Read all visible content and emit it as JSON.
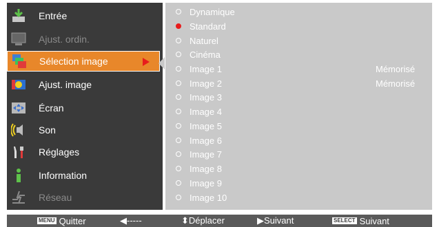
{
  "menu": {
    "items": [
      {
        "label": "Entrée",
        "icon": "input-icon",
        "state": "normal"
      },
      {
        "label": "Ajust. ordin.",
        "icon": "pc-adjust-icon",
        "state": "disabled"
      },
      {
        "label": "Sélection image",
        "icon": "image-select-icon",
        "state": "selected"
      },
      {
        "label": "Ajust. image",
        "icon": "image-adjust-icon",
        "state": "normal"
      },
      {
        "label": "Écran",
        "icon": "screen-icon",
        "state": "normal"
      },
      {
        "label": "Son",
        "icon": "sound-icon",
        "state": "normal"
      },
      {
        "label": "Réglages",
        "icon": "settings-icon",
        "state": "normal"
      },
      {
        "label": "Information",
        "icon": "information-icon",
        "state": "normal"
      },
      {
        "label": "Réseau",
        "icon": "network-icon",
        "state": "disabled"
      }
    ]
  },
  "options": [
    {
      "label": "Dynamique",
      "selected": false,
      "note": ""
    },
    {
      "label": "Standard",
      "selected": true,
      "note": ""
    },
    {
      "label": "Naturel",
      "selected": false,
      "note": ""
    },
    {
      "label": "Cinéma",
      "selected": false,
      "note": ""
    },
    {
      "label": "Image 1",
      "selected": false,
      "note": "Mémorisé"
    },
    {
      "label": "Image 2",
      "selected": false,
      "note": "Mémorisé"
    },
    {
      "label": "Image 3",
      "selected": false,
      "note": ""
    },
    {
      "label": "Image 4",
      "selected": false,
      "note": ""
    },
    {
      "label": "Image 5",
      "selected": false,
      "note": ""
    },
    {
      "label": "Image 6",
      "selected": false,
      "note": ""
    },
    {
      "label": "Image 7",
      "selected": false,
      "note": ""
    },
    {
      "label": "Image 8",
      "selected": false,
      "note": ""
    },
    {
      "label": "Image 9",
      "selected": false,
      "note": ""
    },
    {
      "label": "Image 10",
      "selected": false,
      "note": ""
    }
  ],
  "footer": {
    "menu_key": "MENU",
    "quit": "Quitter",
    "back_arrow": "◀-----",
    "move": "⬍Déplacer",
    "next_arrow": "▶Suivant",
    "select_key": "SELECT",
    "select_next": "Suivant"
  },
  "colors": {
    "menu_bg": "#3a3a3a",
    "selected": "#e8872a",
    "options_bg": "#c9c9c9",
    "radio_on": "#e81c1c",
    "footer_bg": "#5a5a5a"
  }
}
